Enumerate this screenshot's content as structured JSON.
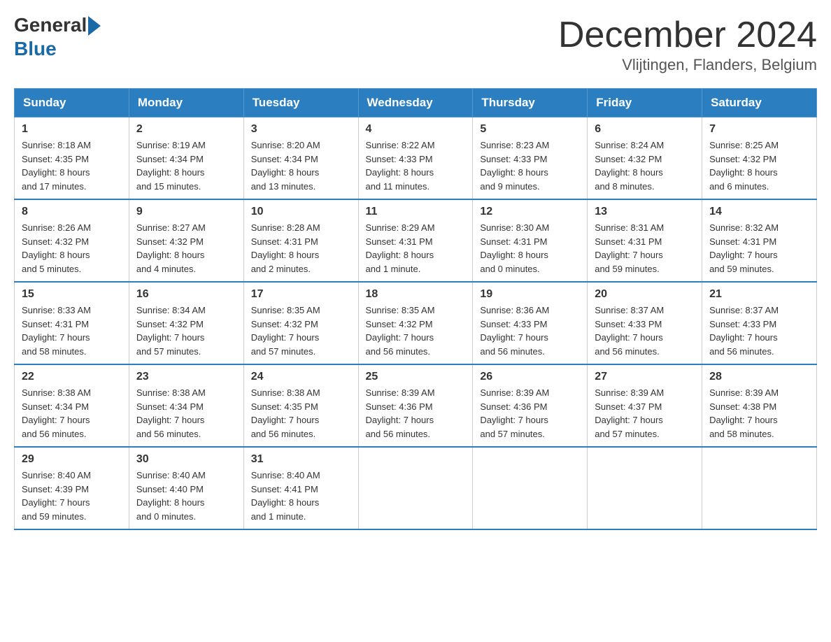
{
  "logo": {
    "general": "General",
    "blue": "Blue"
  },
  "header": {
    "month_year": "December 2024",
    "location": "Vlijtingen, Flanders, Belgium"
  },
  "days_of_week": [
    "Sunday",
    "Monday",
    "Tuesday",
    "Wednesday",
    "Thursday",
    "Friday",
    "Saturday"
  ],
  "weeks": [
    [
      {
        "day": "1",
        "info": "Sunrise: 8:18 AM\nSunset: 4:35 PM\nDaylight: 8 hours\nand 17 minutes."
      },
      {
        "day": "2",
        "info": "Sunrise: 8:19 AM\nSunset: 4:34 PM\nDaylight: 8 hours\nand 15 minutes."
      },
      {
        "day": "3",
        "info": "Sunrise: 8:20 AM\nSunset: 4:34 PM\nDaylight: 8 hours\nand 13 minutes."
      },
      {
        "day": "4",
        "info": "Sunrise: 8:22 AM\nSunset: 4:33 PM\nDaylight: 8 hours\nand 11 minutes."
      },
      {
        "day": "5",
        "info": "Sunrise: 8:23 AM\nSunset: 4:33 PM\nDaylight: 8 hours\nand 9 minutes."
      },
      {
        "day": "6",
        "info": "Sunrise: 8:24 AM\nSunset: 4:32 PM\nDaylight: 8 hours\nand 8 minutes."
      },
      {
        "day": "7",
        "info": "Sunrise: 8:25 AM\nSunset: 4:32 PM\nDaylight: 8 hours\nand 6 minutes."
      }
    ],
    [
      {
        "day": "8",
        "info": "Sunrise: 8:26 AM\nSunset: 4:32 PM\nDaylight: 8 hours\nand 5 minutes."
      },
      {
        "day": "9",
        "info": "Sunrise: 8:27 AM\nSunset: 4:32 PM\nDaylight: 8 hours\nand 4 minutes."
      },
      {
        "day": "10",
        "info": "Sunrise: 8:28 AM\nSunset: 4:31 PM\nDaylight: 8 hours\nand 2 minutes."
      },
      {
        "day": "11",
        "info": "Sunrise: 8:29 AM\nSunset: 4:31 PM\nDaylight: 8 hours\nand 1 minute."
      },
      {
        "day": "12",
        "info": "Sunrise: 8:30 AM\nSunset: 4:31 PM\nDaylight: 8 hours\nand 0 minutes."
      },
      {
        "day": "13",
        "info": "Sunrise: 8:31 AM\nSunset: 4:31 PM\nDaylight: 7 hours\nand 59 minutes."
      },
      {
        "day": "14",
        "info": "Sunrise: 8:32 AM\nSunset: 4:31 PM\nDaylight: 7 hours\nand 59 minutes."
      }
    ],
    [
      {
        "day": "15",
        "info": "Sunrise: 8:33 AM\nSunset: 4:31 PM\nDaylight: 7 hours\nand 58 minutes."
      },
      {
        "day": "16",
        "info": "Sunrise: 8:34 AM\nSunset: 4:32 PM\nDaylight: 7 hours\nand 57 minutes."
      },
      {
        "day": "17",
        "info": "Sunrise: 8:35 AM\nSunset: 4:32 PM\nDaylight: 7 hours\nand 57 minutes."
      },
      {
        "day": "18",
        "info": "Sunrise: 8:35 AM\nSunset: 4:32 PM\nDaylight: 7 hours\nand 56 minutes."
      },
      {
        "day": "19",
        "info": "Sunrise: 8:36 AM\nSunset: 4:33 PM\nDaylight: 7 hours\nand 56 minutes."
      },
      {
        "day": "20",
        "info": "Sunrise: 8:37 AM\nSunset: 4:33 PM\nDaylight: 7 hours\nand 56 minutes."
      },
      {
        "day": "21",
        "info": "Sunrise: 8:37 AM\nSunset: 4:33 PM\nDaylight: 7 hours\nand 56 minutes."
      }
    ],
    [
      {
        "day": "22",
        "info": "Sunrise: 8:38 AM\nSunset: 4:34 PM\nDaylight: 7 hours\nand 56 minutes."
      },
      {
        "day": "23",
        "info": "Sunrise: 8:38 AM\nSunset: 4:34 PM\nDaylight: 7 hours\nand 56 minutes."
      },
      {
        "day": "24",
        "info": "Sunrise: 8:38 AM\nSunset: 4:35 PM\nDaylight: 7 hours\nand 56 minutes."
      },
      {
        "day": "25",
        "info": "Sunrise: 8:39 AM\nSunset: 4:36 PM\nDaylight: 7 hours\nand 56 minutes."
      },
      {
        "day": "26",
        "info": "Sunrise: 8:39 AM\nSunset: 4:36 PM\nDaylight: 7 hours\nand 57 minutes."
      },
      {
        "day": "27",
        "info": "Sunrise: 8:39 AM\nSunset: 4:37 PM\nDaylight: 7 hours\nand 57 minutes."
      },
      {
        "day": "28",
        "info": "Sunrise: 8:39 AM\nSunset: 4:38 PM\nDaylight: 7 hours\nand 58 minutes."
      }
    ],
    [
      {
        "day": "29",
        "info": "Sunrise: 8:40 AM\nSunset: 4:39 PM\nDaylight: 7 hours\nand 59 minutes."
      },
      {
        "day": "30",
        "info": "Sunrise: 8:40 AM\nSunset: 4:40 PM\nDaylight: 8 hours\nand 0 minutes."
      },
      {
        "day": "31",
        "info": "Sunrise: 8:40 AM\nSunset: 4:41 PM\nDaylight: 8 hours\nand 1 minute."
      },
      {
        "day": "",
        "info": ""
      },
      {
        "day": "",
        "info": ""
      },
      {
        "day": "",
        "info": ""
      },
      {
        "day": "",
        "info": ""
      }
    ]
  ]
}
